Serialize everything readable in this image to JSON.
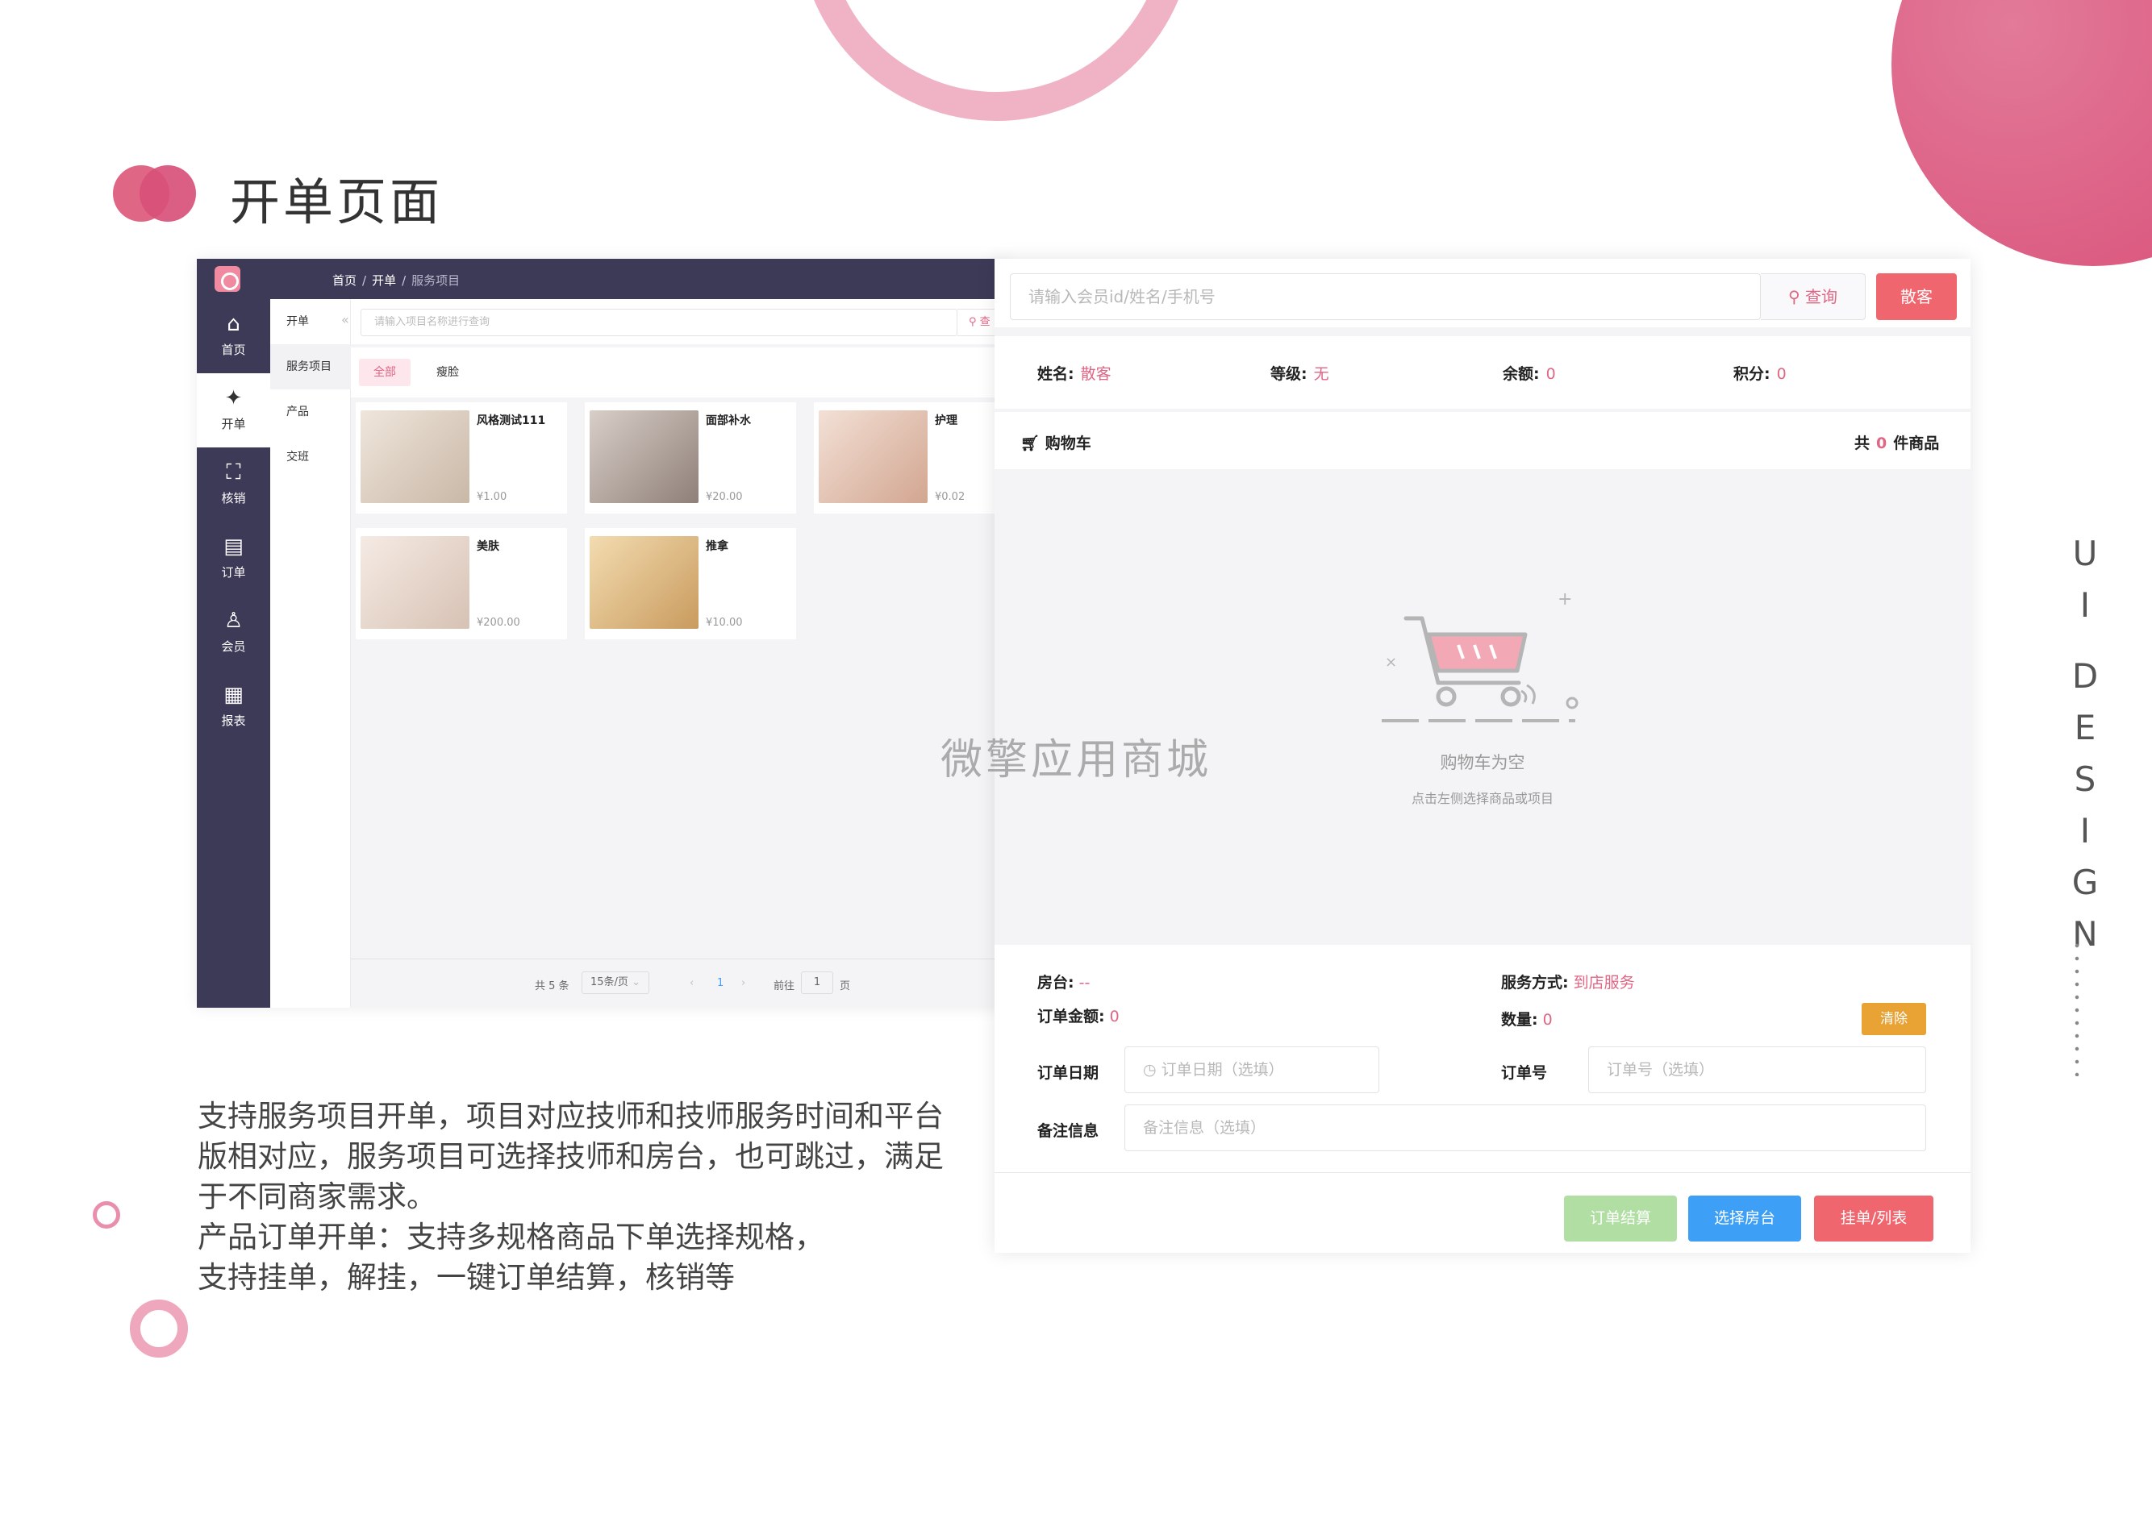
{
  "page": {
    "title": "开单页面",
    "side_label": [
      "U",
      "I",
      "D",
      "E",
      "S",
      "I",
      "G",
      "N"
    ],
    "description": [
      "支持服务项目开单，项目对应技师和技师服务时间和平台",
      "版相对应，服务项目可选择技师和房台，也可跳过，满足",
      "于不同商家需求。",
      "产品订单开单：支持多规格商品下单选择规格，",
      "支持挂单，解挂，一键订单结算，核销等"
    ],
    "watermark": "微擎应用商城"
  },
  "admin": {
    "breadcrumb": [
      "首页",
      "开单",
      "服务项目"
    ],
    "nav": [
      {
        "label": "首页",
        "icon": "home-icon",
        "glyph": "⌂"
      },
      {
        "label": "开单",
        "icon": "aperture-icon",
        "glyph": "✦"
      },
      {
        "label": "核销",
        "icon": "scan-icon",
        "glyph": "⛶"
      },
      {
        "label": "订单",
        "icon": "clipboard-icon",
        "glyph": "▤"
      },
      {
        "label": "会员",
        "icon": "user-icon",
        "glyph": "♙"
      },
      {
        "label": "报表",
        "icon": "report-icon",
        "glyph": "▦"
      }
    ],
    "subnav": [
      "开单",
      "服务项目",
      "产品",
      "交班"
    ],
    "subnav_active": 1,
    "search_placeholder": "请输入项目名称进行查询",
    "search_button": "查",
    "tabs": [
      "全部",
      "瘦脸"
    ],
    "products": [
      {
        "name": "风格测试111",
        "price": "¥1.00",
        "color": "#ddd2c8"
      },
      {
        "name": "面部补水",
        "price": "¥20.00",
        "color": "#c9bcb3"
      },
      {
        "name": "护理",
        "price": "¥0.02",
        "color": "#e8d3c6"
      },
      {
        "name": "美肤",
        "price": "¥200.00",
        "color": "#eadcd2"
      },
      {
        "name": "推拿",
        "price": "¥10.00",
        "color": "#e3c89c"
      }
    ],
    "pager": {
      "total": "共 5 条",
      "page_size": "15条/页",
      "prev": "‹",
      "current": "1",
      "next": "›",
      "goto_prefix": "前往",
      "goto_value": "1",
      "goto_suffix": "页"
    }
  },
  "pos": {
    "member_placeholder": "请输入会员id/姓名/手机号",
    "query_button": "查询",
    "walkin_button": "散客",
    "member": [
      {
        "label": "姓名:",
        "value": "散客"
      },
      {
        "label": "等级:",
        "value": "无"
      },
      {
        "label": "余额:",
        "value": "0"
      },
      {
        "label": "积分:",
        "value": "0"
      }
    ],
    "cart_title": "购物车",
    "cart_count_prefix": "共",
    "cart_count": "0",
    "cart_count_suffix": "件商品",
    "empty_title": "购物车为空",
    "empty_sub": "点击左侧选择商品或项目",
    "room_label": "房台:",
    "room_value": "--",
    "service_label": "服务方式:",
    "service_value": "到店服务",
    "amount_label": "订单金额:",
    "amount_value": "0",
    "qty_label": "数量:",
    "qty_value": "0",
    "clear_button": "清除",
    "date_label": "订单日期",
    "date_placeholder": "订单日期（选填）",
    "order_no_label": "订单号",
    "order_no_placeholder": "订单号（选填）",
    "remark_label": "备注信息",
    "remark_placeholder": "备注信息（选填）",
    "buttons": [
      {
        "label": "订单结算",
        "color": "#b1dfa3"
      },
      {
        "label": "选择房台",
        "color": "#3d9ff5"
      },
      {
        "label": "挂单/列表",
        "color": "#f0666e"
      }
    ]
  }
}
